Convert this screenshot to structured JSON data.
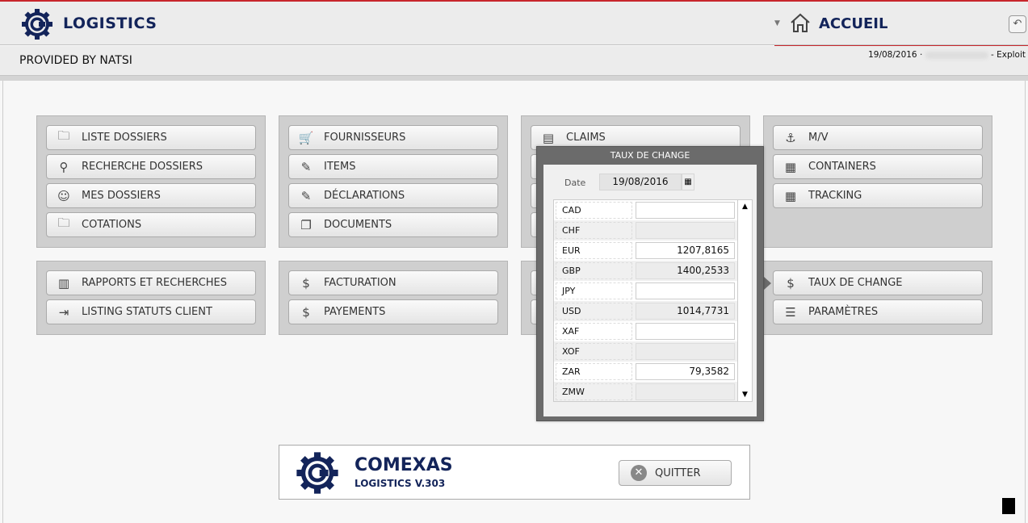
{
  "header": {
    "brand": "LOGISTICS",
    "provided_by": "PROVIDED BY NATSI",
    "page": "ACCUEIL",
    "date": "19/08/2016",
    "user_suffix": "- Exploit",
    "accent": "#c8262c",
    "brand_color": "#13245a"
  },
  "panels": [
    {
      "buttons": [
        {
          "label": "LISTE DOSSIERS",
          "icon": "folder-icon"
        },
        {
          "label": "RECHERCHE DOSSIERS",
          "icon": "search-icon"
        },
        {
          "label": "MES DOSSIERS",
          "icon": "user-icon"
        },
        {
          "label": "COTATIONS",
          "icon": "folder-icon"
        }
      ]
    },
    {
      "buttons": [
        {
          "label": "FOURNISSEURS",
          "icon": "cart-icon"
        },
        {
          "label": "ITEMS",
          "icon": "puzzle-icon"
        },
        {
          "label": "DÉCLARATIONS",
          "icon": "edit-icon"
        },
        {
          "label": "DOCUMENTS",
          "icon": "documents-icon"
        }
      ]
    },
    {
      "buttons": [
        {
          "label": "CLAIMS",
          "icon": "comment-icon"
        }
      ]
    },
    {
      "buttons": [
        {
          "label": "M/V",
          "icon": "ship-icon"
        },
        {
          "label": "CONTAINERS",
          "icon": "grid-icon"
        },
        {
          "label": "TRACKING",
          "icon": "calendar-icon"
        }
      ]
    },
    {
      "buttons": [
        {
          "label": "RAPPORTS ET RECHERCHES",
          "icon": "bar-chart-icon"
        },
        {
          "label": "LISTING STATUTS CLIENT",
          "icon": "import-icon"
        }
      ]
    },
    {
      "buttons": [
        {
          "label": "FACTURATION",
          "icon": "dollar-doc-icon"
        },
        {
          "label": "PAYEMENTS",
          "icon": "dollar-doc-icon"
        }
      ]
    },
    {
      "buttons": []
    },
    {
      "buttons": [
        {
          "label": "TAUX DE CHANGE",
          "icon": "dollar-doc-icon"
        },
        {
          "label": "PARAMÈTRES",
          "icon": "sliders-icon"
        }
      ]
    }
  ],
  "popup": {
    "title": "TAUX DE CHANGE",
    "date_label": "Date",
    "date_value": "19/08/2016",
    "rates": [
      {
        "code": "CAD",
        "value": ""
      },
      {
        "code": "CHF",
        "value": ""
      },
      {
        "code": "EUR",
        "value": "1207,8165"
      },
      {
        "code": "GBP",
        "value": "1400,2533"
      },
      {
        "code": "JPY",
        "value": ""
      },
      {
        "code": "USD",
        "value": "1014,7731"
      },
      {
        "code": "XAF",
        "value": ""
      },
      {
        "code": "XOF",
        "value": ""
      },
      {
        "code": "ZAR",
        "value": "79,3582"
      },
      {
        "code": "ZMW",
        "value": ""
      }
    ]
  },
  "footer": {
    "name": "COMEXAS",
    "version": "LOGISTICS V.303",
    "quit": "QUITTER"
  }
}
